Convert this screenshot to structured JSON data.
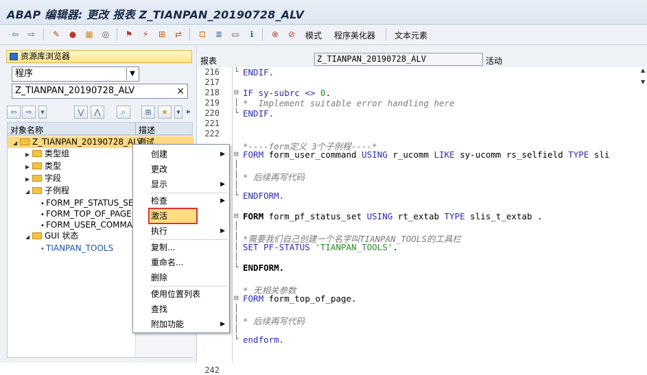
{
  "title": "ABAP 编辑器: 更改 报表 Z_TIANPAN_20190728_ALV",
  "toolbar": {
    "mode_label": "模式",
    "pretty_printer_label": "程序美化器",
    "text_elements_label": "文本元素"
  },
  "left": {
    "repo_browser": "资源库浏览器",
    "object_type": "程序",
    "object_name": "Z_TIANPAN_20190728_ALV",
    "col_name": "对象名称",
    "col_desc": "描述",
    "tree": [
      {
        "label": "Z_TIANPAN_20190728_ALV",
        "desc": "测试"
      },
      {
        "label": "类型组"
      },
      {
        "label": "类型"
      },
      {
        "label": "字段"
      },
      {
        "label": "子例程"
      },
      {
        "label": "FORM_PF_STATUS_SET"
      },
      {
        "label": "FORM_TOP_OF_PAGE"
      },
      {
        "label": "FORM_USER_COMMAND"
      },
      {
        "label": "GUI 状态"
      },
      {
        "label": "TIANPAN_TOOLS"
      }
    ]
  },
  "right": {
    "label": "报表",
    "program": "Z_TIANPAN_20190728_ALV",
    "status": "活动"
  },
  "code": {
    "line_numbers": [
      "216",
      "217",
      "218",
      "219",
      "220",
      "221",
      "222",
      "",
      "",
      "",
      "",
      "",
      "",
      "",
      "",
      "",
      "",
      "",
      "",
      "",
      "",
      "",
      "",
      "",
      "",
      "",
      "",
      "",
      "",
      "242"
    ],
    "lines": {
      "l1": "ENDIF.",
      "l3a": "IF sy-subrc ",
      "l3b": "<>",
      "l3c": "0",
      "l4": "*  Implement suitable error handling here",
      "l5": "ENDIF.",
      "l8": "*----form定义 3个子例程----*",
      "l9a": "FORM",
      "l9b": " form_user_command ",
      "l9c": "USING",
      "l9d": " r_ucomm ",
      "l9e": "LIKE",
      "l9f": " sy-ucomm rs_selfield ",
      "l9g": "TYPE",
      "l9h": " sli",
      "l11": "* 后续再写代码",
      "l13": "ENDFORM.",
      "l15a": "FORM",
      "l15b": " form_pf_status_set ",
      "l15c": "USING",
      "l15d": " rt_extab ",
      "l15e": "TYPE",
      "l15f": " slis_t_extab .",
      "l17": "*需要我们自己创建一个名字叫TIANPAN_TOOLS的工具栏",
      "l18a": "SET PF-STATUS ",
      "l18b": "'TIANPAN_TOOLS'",
      "l18c": ".",
      "l20": "ENDFORM.",
      "l22": "* 无相关参数",
      "l23a": "FORM",
      "l23b": " form_top_of_page.",
      "l25": "* 后续再写代码",
      "l27": "endform."
    }
  },
  "context_menu": {
    "items": [
      "创建",
      "更改",
      "显示",
      "检查",
      "激活",
      "执行",
      "复制...",
      "重命名...",
      "删除",
      "使用位置列表",
      "查找",
      "附加功能"
    ]
  }
}
